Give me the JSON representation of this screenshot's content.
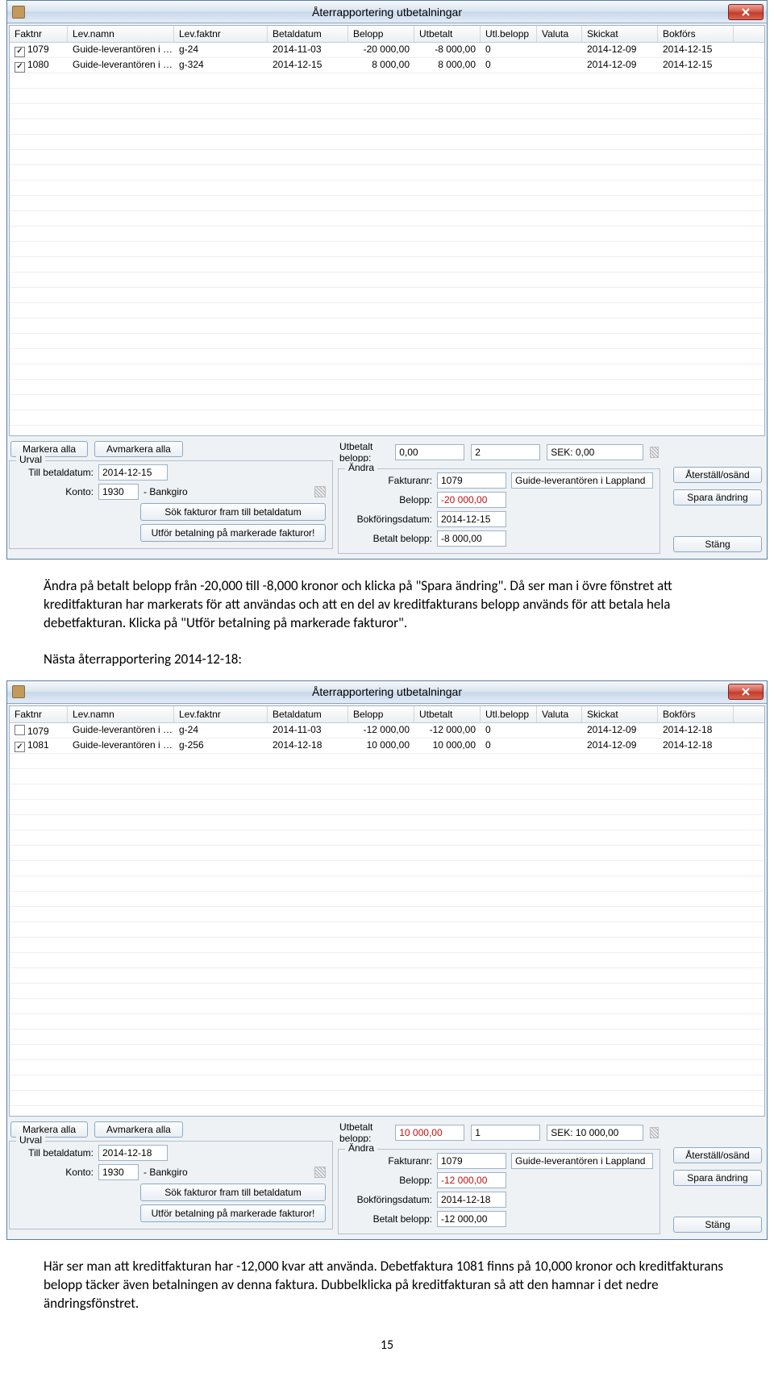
{
  "window_title": "Återrapportering utbetalningar",
  "columns": [
    "Faktnr",
    "Lev.namn",
    "Lev.faktnr",
    "Betaldatum",
    "Belopp",
    "Utbetalt",
    "Utl.belopp",
    "Valuta",
    "Skickat",
    "Bokförs"
  ],
  "win1": {
    "rows": [
      {
        "checked": true,
        "faktnr": "1079",
        "lev": "Guide-leverantören i …",
        "levfakt": "g-24",
        "betdat": "2014-11-03",
        "belopp": "-20 000,00",
        "utbet": "-8 000,00",
        "utl": "0",
        "valuta": "",
        "skickat": "2014-12-09",
        "bokfors": "2014-12-15"
      },
      {
        "checked": true,
        "faktnr": "1080",
        "lev": "Guide-leverantören i …",
        "levfakt": "g-324",
        "betdat": "2014-12-15",
        "belopp": "8 000,00",
        "utbet": "8 000,00",
        "utl": "0",
        "valuta": "",
        "skickat": "2014-12-09",
        "bokfors": "2014-12-15"
      }
    ],
    "utbetalt_belopp": "0,00",
    "count": "2",
    "sek": "SEK: 0,00",
    "urval_betdatum": "2014-12-15",
    "urval_konto": "1930",
    "urval_konto_label": "- Bankgiro",
    "andra_fakturanr": "1079",
    "andra_lev": "Guide-leverantören i Lappland",
    "andra_belopp": "-20 000,00",
    "andra_bokdat": "2014-12-15",
    "andra_betalt": "-8 000,00"
  },
  "win2": {
    "rows": [
      {
        "checked": false,
        "faktnr": "1079",
        "lev": "Guide-leverantören i …",
        "levfakt": "g-24",
        "betdat": "2014-11-03",
        "belopp": "-12 000,00",
        "utbet": "-12 000,00",
        "utl": "0",
        "valuta": "",
        "skickat": "2014-12-09",
        "bokfors": "2014-12-18"
      },
      {
        "checked": true,
        "faktnr": "1081",
        "lev": "Guide-leverantören i …",
        "levfakt": "g-256",
        "betdat": "2014-12-18",
        "belopp": "10 000,00",
        "utbet": "10 000,00",
        "utl": "0",
        "valuta": "",
        "skickat": "2014-12-09",
        "bokfors": "2014-12-18"
      }
    ],
    "utbetalt_belopp": "10 000,00",
    "count": "1",
    "sek": "SEK: 10 000,00",
    "urval_betdatum": "2014-12-18",
    "urval_konto": "1930",
    "urval_konto_label": "- Bankgiro",
    "andra_fakturanr": "1079",
    "andra_lev": "Guide-leverantören i Lappland",
    "andra_belopp": "-12 000,00",
    "andra_bokdat": "2014-12-18",
    "andra_betalt": "-12 000,00"
  },
  "labels": {
    "markera_alla": "Markera alla",
    "avmarkera_alla": "Avmarkera alla",
    "utbetalt_belopp": "Utbetalt belopp:",
    "urval": "Urval",
    "andra": "Ändra",
    "till_betaldatum": "Till betaldatum:",
    "konto": "Konto:",
    "sok_fakturor": "Sök fakturor fram till betaldatum",
    "utfor_betalning": "Utför betalning på markerade fakturor!",
    "fakturanr": "Fakturanr:",
    "belopp": "Belopp:",
    "bokforingsdatum": "Bokföringsdatum:",
    "betalt_belopp": "Betalt belopp:",
    "aterstall": "Återställ/osänd",
    "spara": "Spara ändring",
    "stang": "Stäng"
  },
  "para1": "Ändra på betalt belopp från -20,000 till -8,000 kronor och klicka på \"Spara ändring\". Då ser man i övre fönstret att kreditfakturan har markerats för att användas och att en del av kreditfakturans belopp används för att betala hela debetfakturan. Klicka på \"Utför betalning på markerade fakturor\".",
  "para2_heading": "Nästa återrapportering 2014-12-18:",
  "para3": "Här ser man att kreditfakturan har -12,000 kvar att använda. Debetfaktura 1081 finns på 10,000 kronor och kreditfakturans belopp täcker även betalningen av denna faktura. Dubbelklicka på kreditfakturan så att den hamnar i det nedre ändringsfönstret.",
  "pagenum": "15"
}
